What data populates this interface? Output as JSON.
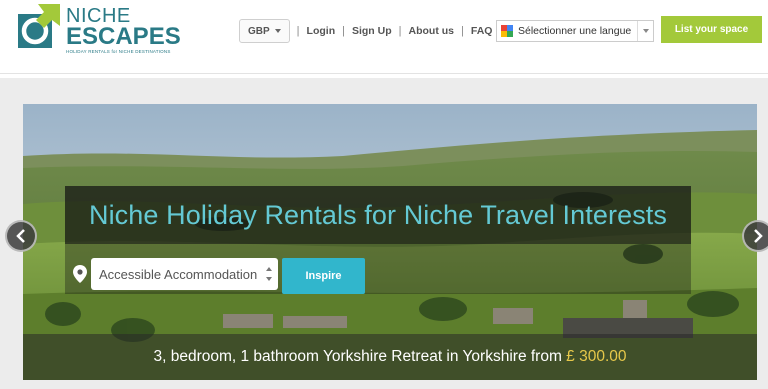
{
  "brand": {
    "name_top": "NICHE",
    "name_bottom": "ESCAPES",
    "tagline": "HOLIDAY RENTALS for NICHE DESTINATIONS",
    "color": "#2a7a86"
  },
  "nav": {
    "currency": "GBP",
    "links": [
      "Login",
      "Sign Up",
      "About us",
      "FAQ"
    ]
  },
  "language": {
    "label": "Sélectionner une langue"
  },
  "cta": {
    "label": "List your space",
    "color": "#a3c93a"
  },
  "hero": {
    "title": "Niche Holiday Rentals for Niche Travel Interests",
    "title_color": "#64c9d4",
    "search_value": "Accessible Accommodation",
    "button_label": "Inspire",
    "button_color": "#31b6cc",
    "caption_text": "3, bedroom, 1 bathroom Yorkshire Retreat in Yorkshire from ",
    "caption_price": "£ 300.00",
    "price_color": "#e6c84a"
  },
  "icons": {
    "location": "map-pin-icon",
    "prev": "chevron-left-icon",
    "next": "chevron-right-icon",
    "google": "google-translate-icon"
  }
}
